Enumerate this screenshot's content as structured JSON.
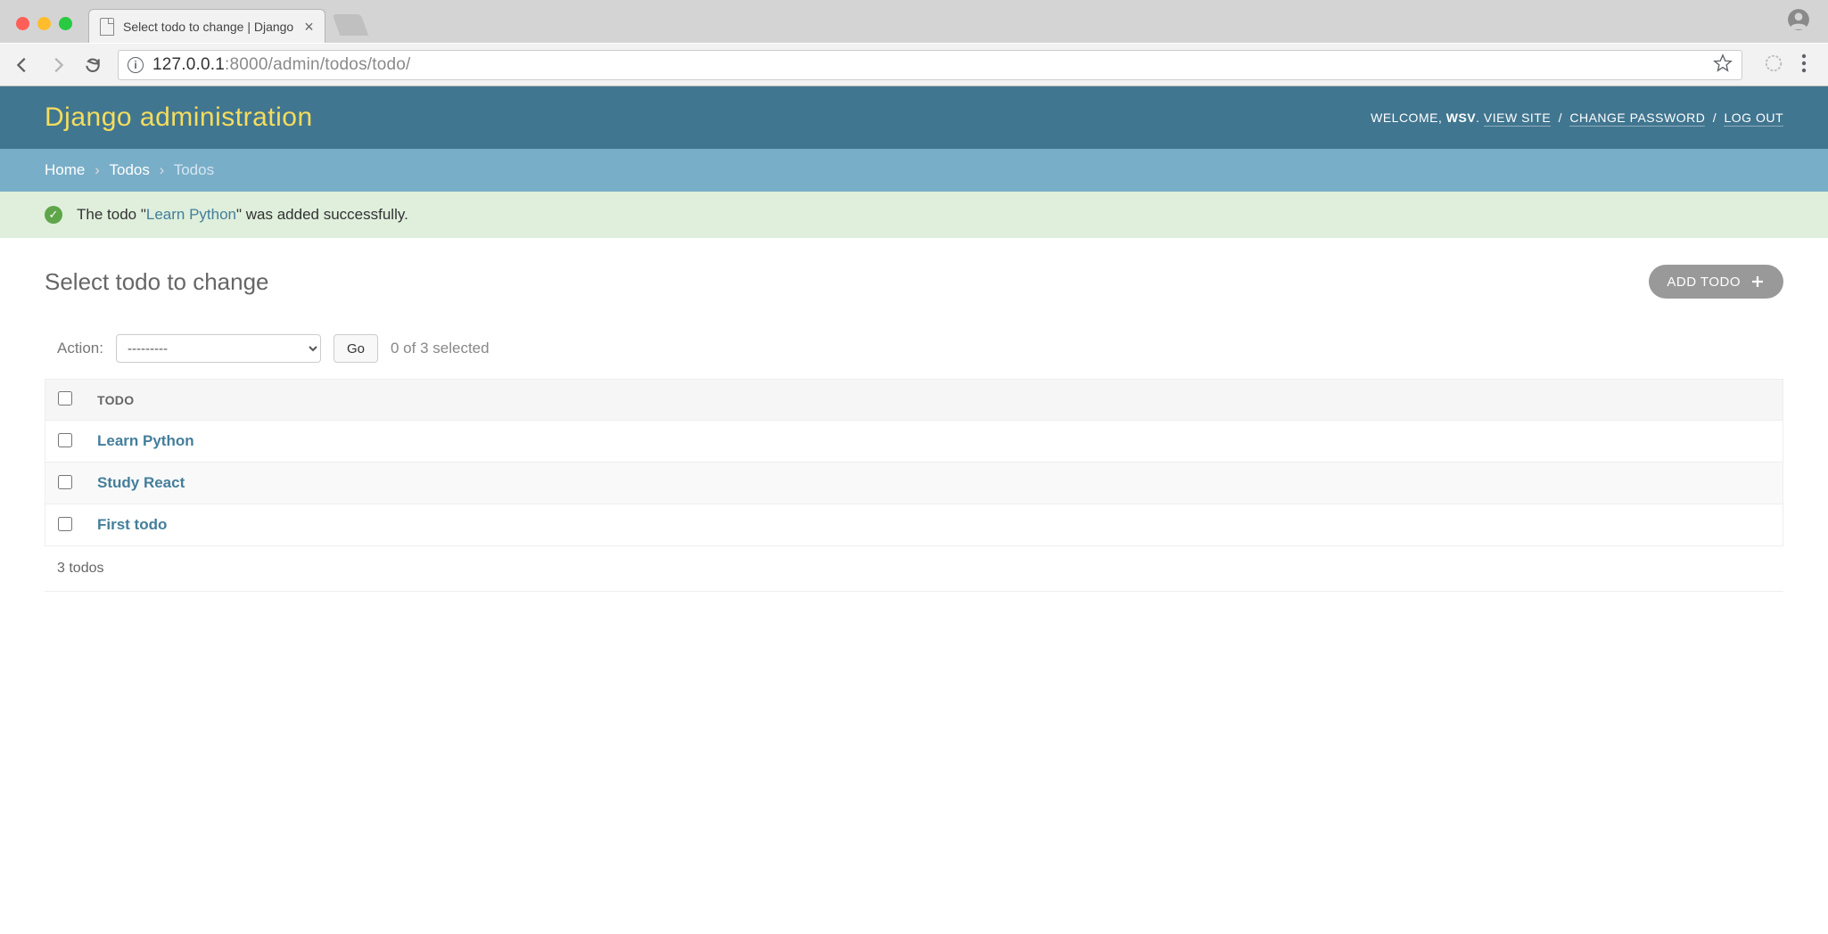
{
  "browser": {
    "tab_title": "Select todo to change | Django",
    "url_host": "127.0.0.1",
    "url_port_path": ":8000/admin/todos/todo/"
  },
  "header": {
    "title": "Django administration",
    "welcome": "WELCOME,",
    "username": "WSV",
    "view_site": "VIEW SITE",
    "change_password": "CHANGE PASSWORD",
    "logout": "LOG OUT"
  },
  "breadcrumb": {
    "home": "Home",
    "app": "Todos",
    "current": "Todos"
  },
  "message": {
    "prefix": "The todo \"",
    "link": "Learn Python",
    "suffix": "\" was added successfully."
  },
  "page": {
    "title": "Select todo to change",
    "add_button": "ADD TODO"
  },
  "actions": {
    "label": "Action:",
    "placeholder": "---------",
    "go": "Go",
    "selection_count": "0 of 3 selected"
  },
  "table": {
    "header": "TODO",
    "rows": [
      {
        "name": "Learn Python"
      },
      {
        "name": "Study React"
      },
      {
        "name": "First todo"
      }
    ]
  },
  "paginator": {
    "text": "3 todos"
  }
}
